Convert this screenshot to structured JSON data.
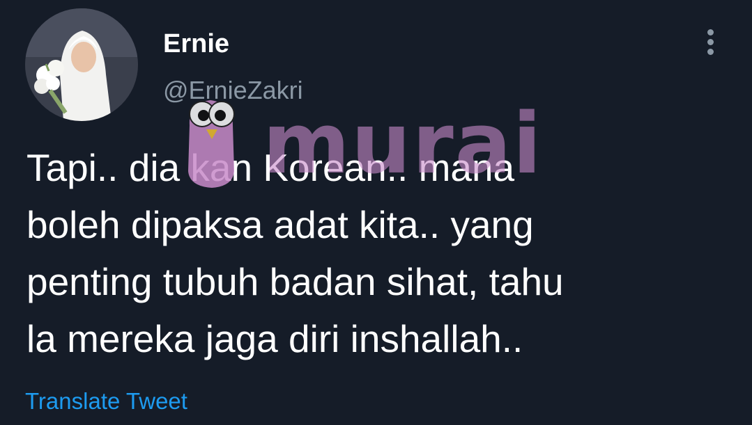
{
  "tweet": {
    "author": {
      "display_name": "Ernie",
      "handle": "@ErnieZakri",
      "avatar_icon": "profile-photo"
    },
    "menu_icon": "more-vertical-icon",
    "text": "Tapi.. dia kan Korean.. mana\nboleh dipaksa adat kita.. yang\npenting tubuh badan sihat, tahu\nla mereka jaga diri inshallah..",
    "translate_label": "Translate Tweet"
  },
  "watermark": {
    "brand_text": "murai",
    "logo_icon": "owl-mascot-icon"
  },
  "colors": {
    "background": "#151c28",
    "text": "#ffffff",
    "secondary_text": "#8b98a5",
    "link": "#1d9bf0",
    "watermark_pink": "#c88bc9"
  }
}
